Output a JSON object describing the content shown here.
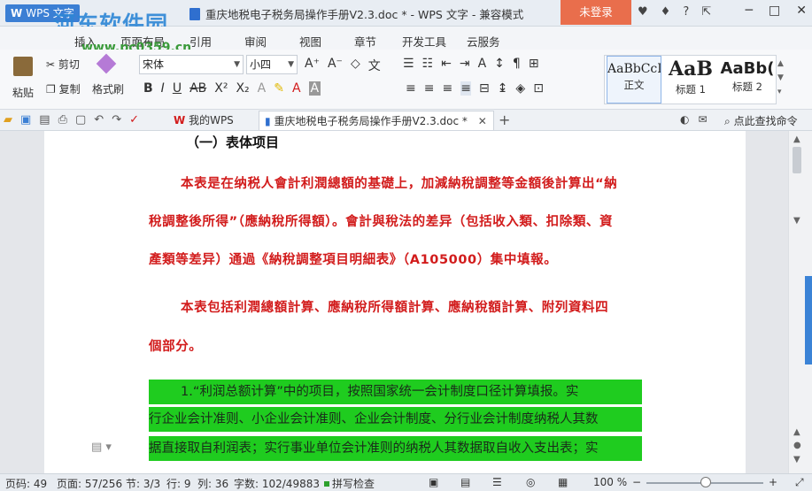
{
  "titlebar": {
    "app_name": "WPS 文字",
    "app_letter": "W",
    "watermark": "河东软件园",
    "watermark_url": "www.pc0359.cn",
    "doc_title": "重庆地税电子税务局操作手册V2.3.doc * - WPS 文字 - 兼容模式",
    "login_label": "未登录",
    "window_controls": [
      "─",
      "□",
      "✕"
    ]
  },
  "menu": {
    "tabs": [
      "插入",
      "页面布局",
      "引用",
      "审阅",
      "视图",
      "章节",
      "开发工具",
      "云服务"
    ]
  },
  "ribbon": {
    "paste_label": "粘贴",
    "cut_label": "剪切",
    "copy_label": "复制",
    "format_painter_label": "格式刷",
    "font_name": "宋体",
    "font_size": "小四",
    "styles": [
      {
        "preview": "AaBbCcI",
        "label": "正文"
      },
      {
        "preview": "AaB",
        "label": "标题 1"
      },
      {
        "preview": "AaBb(",
        "label": "标题 2"
      }
    ]
  },
  "tabs": {
    "home_tab": "我的WPS",
    "doc_tab": "重庆地税电子税务局操作手册V2.3.doc *",
    "search_cmd": "点此查找命令"
  },
  "document": {
    "heading": "（一）表体项目",
    "lines": [
      "本表是在纳税人會計利潤總額的基礎上，加減納稅調整等金額後計算出“納",
      "稅調整後所得”（應納稅所得額）。會計與稅法的差异（包括收入類、扣除類、資",
      "產類等差异）通過《納稅調整項目明細表》（A105000）集中填報。",
      "本表包括利潤總額計算、應納稅所得額計算、應納稅額計算、附列資料四",
      "個部分。",
      "1.“利润总额计算”中的项目，按照国家统一会计制度口径计算填报。实",
      "行企业会计准则、小企业会计准则、企业会计制度、分行业会计制度纳税人其数",
      "据直接取自利润表；实行事业单位会计准则的纳税人其数据取自收入支出表；实"
    ]
  },
  "status": {
    "page_num": "页码: 49",
    "page_of": "页面: 57/256",
    "section": "节: 3/3",
    "row": "行: 9",
    "col": "列: 36",
    "word_count": "字数: 102/49883",
    "spell_check": "拼写检查",
    "zoom": "100 %"
  },
  "colors": {
    "accent": "#3b7fd4",
    "login_bg": "#e96e4c",
    "red_text": "#d21c1c",
    "highlight": "#1fcc1f"
  }
}
